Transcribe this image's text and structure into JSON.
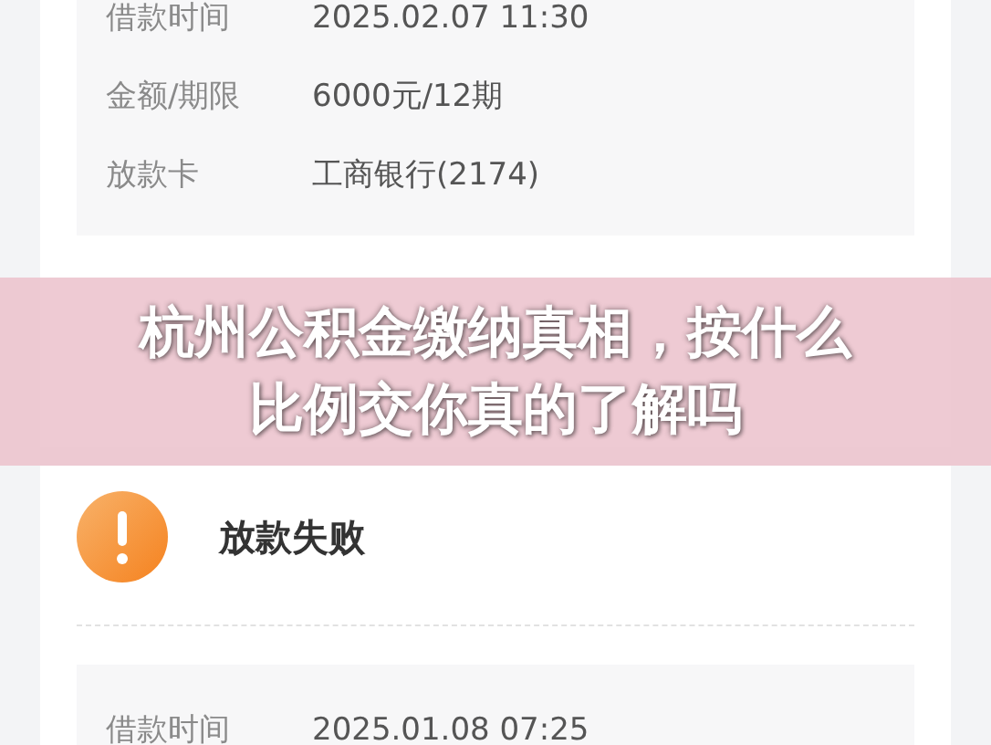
{
  "records": [
    {
      "fields": [
        {
          "label": "借款时间",
          "value": "2025.02.07 11:30"
        },
        {
          "label": "金额/期限",
          "value": "6000元/12期"
        },
        {
          "label": "放款卡",
          "value": "工商银行(2174)"
        }
      ]
    },
    {
      "status": {
        "kind": "failed",
        "text": "放款失败"
      },
      "fields": [
        {
          "label": "借款时间",
          "value": "2025.01.08 07:25"
        }
      ]
    }
  ],
  "banner": {
    "title_lines": [
      "杭州公积金缴纳真相，按什么",
      "比例交你真的了解吗"
    ]
  }
}
